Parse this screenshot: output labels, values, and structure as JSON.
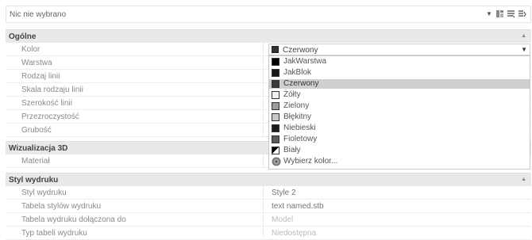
{
  "topbar": {
    "selection": "Nic nie wybrano"
  },
  "sections": {
    "general": "Ogólne",
    "viz3d": "Wizualizacja 3D",
    "print": "Styl wydruku"
  },
  "general_rows": [
    "Kolor",
    "Warstwa",
    "Rodzaj linii",
    "Skala rodzaju linii",
    "Szerokość linii",
    "Przezroczystość",
    "Grubość"
  ],
  "viz3d_rows": [
    "Materiał"
  ],
  "print_rows": [
    {
      "label": "Styl wydruku",
      "value": "Style 2"
    },
    {
      "label": "Tabela stylów wydruku",
      "value": "text named.stb"
    },
    {
      "label": "Tabela wydruku dołączona do",
      "value": "Model"
    },
    {
      "label": "Typ tabeli wydruku",
      "value": "Niedostępna"
    }
  ],
  "color_combo": {
    "value": "Czerwony",
    "swatch": "#303030"
  },
  "color_options": [
    {
      "label": "JakWarstwa",
      "swatch": "#000000"
    },
    {
      "label": "JakBlok",
      "swatch": "#1a1a1a"
    },
    {
      "label": "Czerwony",
      "swatch": "#3a3a3a",
      "selected": true
    },
    {
      "label": "Żółty",
      "swatch": "#f2f2f2"
    },
    {
      "label": "Zielony",
      "swatch": "#9a9a9a"
    },
    {
      "label": "Błękitny",
      "swatch": "#c8c8c8"
    },
    {
      "label": "Niebieski",
      "swatch": "#1c1c1c"
    },
    {
      "label": "Fioletowy",
      "swatch": "#5a5a5a"
    },
    {
      "label": "Biały",
      "swatch": "#000000"
    },
    {
      "label": "Wybierz kolor...",
      "swatch": "wheel"
    }
  ]
}
